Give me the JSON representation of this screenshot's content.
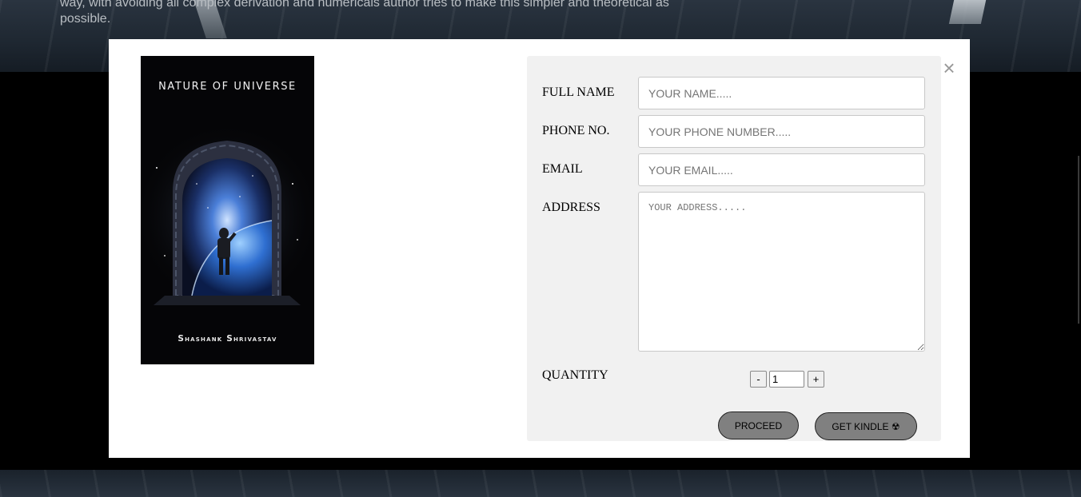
{
  "background": {
    "paragraph": "way, with avoiding all complex derivation and numericals author tries to make this simpler and theoretical as possible."
  },
  "modal": {
    "close_glyph": "×",
    "book": {
      "title": "NATURE OF UNIVERSE",
      "author": "Shashank Shrivastav"
    },
    "form": {
      "full_name_label": "FULL NAME",
      "full_name_placeholder": "YOUR NAME.....",
      "phone_label": "PHONE NO.",
      "phone_placeholder": "YOUR PHONE NUMBER.....",
      "email_label": "EMAIL",
      "email_placeholder": "YOUR EMAIL.....",
      "address_label": "ADDRESS",
      "address_placeholder": "YOUR ADDRESS.....",
      "quantity_label": "QUANTITY",
      "quantity_value": "1",
      "decrement_label": "-",
      "increment_label": "+",
      "proceed_label": "PROCEED",
      "kindle_label": "GET KINDLE ☢"
    }
  },
  "colors": {
    "button_fill": "#808080",
    "panel_bg": "#f1f1f1",
    "overlay_bg": "#000000"
  }
}
